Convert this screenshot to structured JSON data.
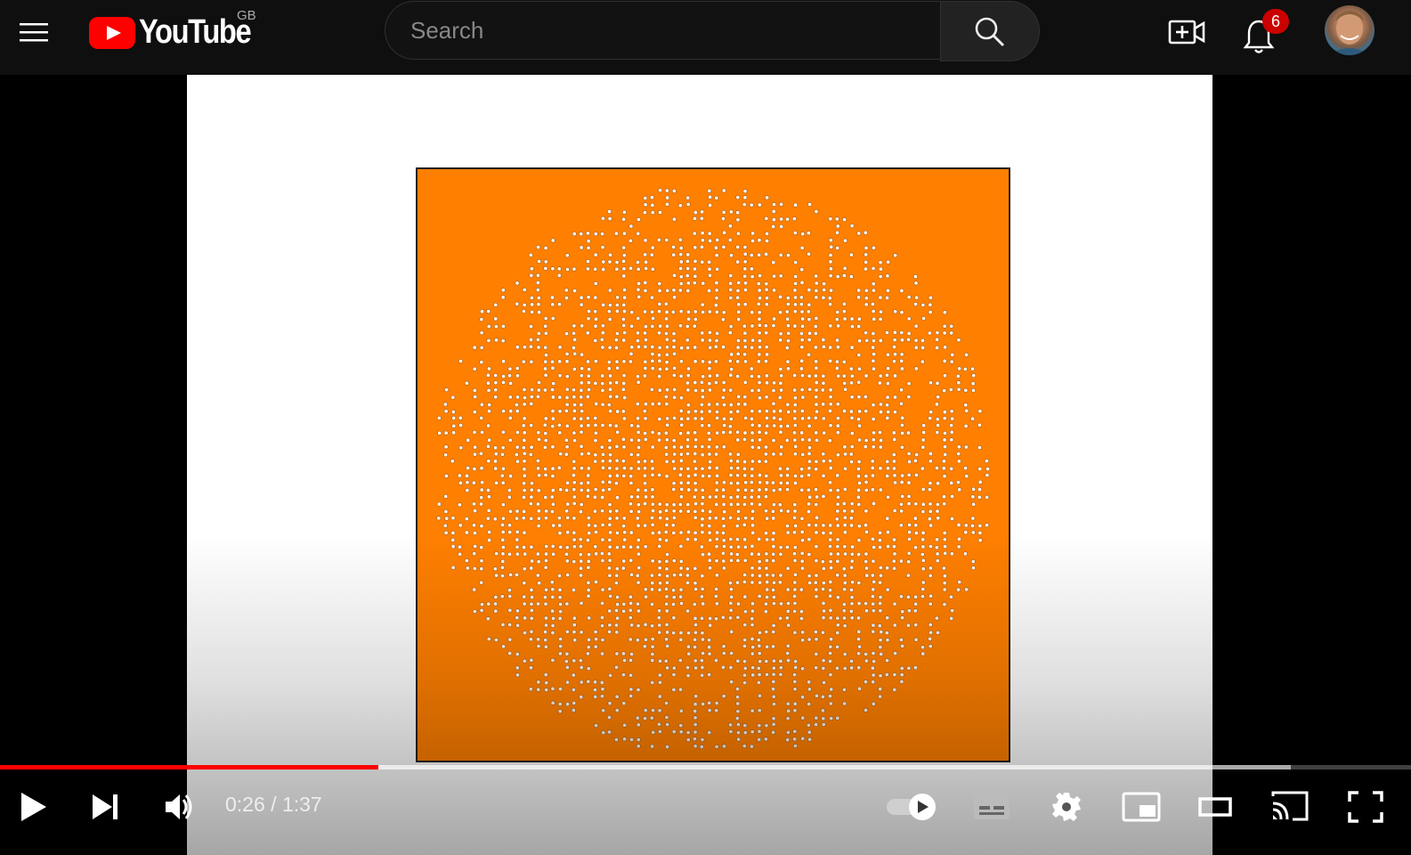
{
  "masthead": {
    "logo_text": "YouTube",
    "region": "GB",
    "search_placeholder": "Search",
    "notification_count": "6",
    "icons": [
      "menu-icon",
      "youtube-logo-icon",
      "search-icon",
      "create-video-icon",
      "bell-icon",
      "avatar"
    ]
  },
  "player": {
    "current_time": "0:26",
    "duration": "1:37",
    "played_fraction": 0.268,
    "buffered_fraction": 0.915,
    "autoplay": "on",
    "colors": {
      "played": "#ff0000",
      "frame_background": "#ff7f00",
      "masthead": "#0f0f0f"
    },
    "control_icons": [
      "play-icon",
      "next-icon",
      "volume-icon",
      "autoplay-toggle-icon",
      "subtitles-icon",
      "settings-icon",
      "miniplayer-icon",
      "theater-mode-icon",
      "cast-icon",
      "fullscreen-icon"
    ]
  }
}
